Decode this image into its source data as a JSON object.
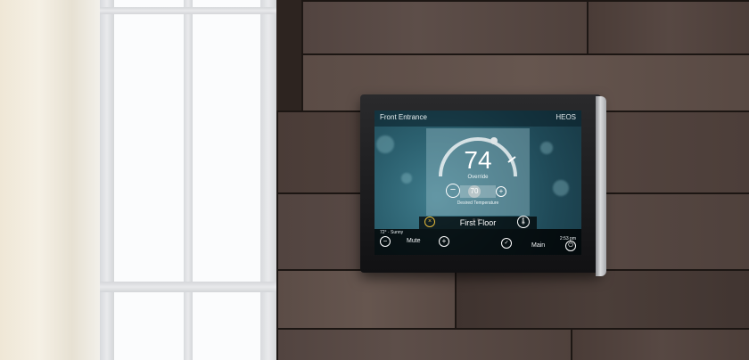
{
  "screen": {
    "header_title": "Front Entrance",
    "header_logo": "HEOS",
    "temperature": "74",
    "mode": "Override",
    "setpoint": "70",
    "setpoint_label": "Desired Temperature",
    "zone_name": "First Floor",
    "weather": "72° · Sunny",
    "time": "2:53 pm",
    "mute_label": "Mute",
    "main_label": "Main",
    "decrease_symbol": "−",
    "increase_symbol": "+",
    "cancel_symbol": "×",
    "thermo_symbol": "🌡",
    "power_symbol": "⏻"
  }
}
